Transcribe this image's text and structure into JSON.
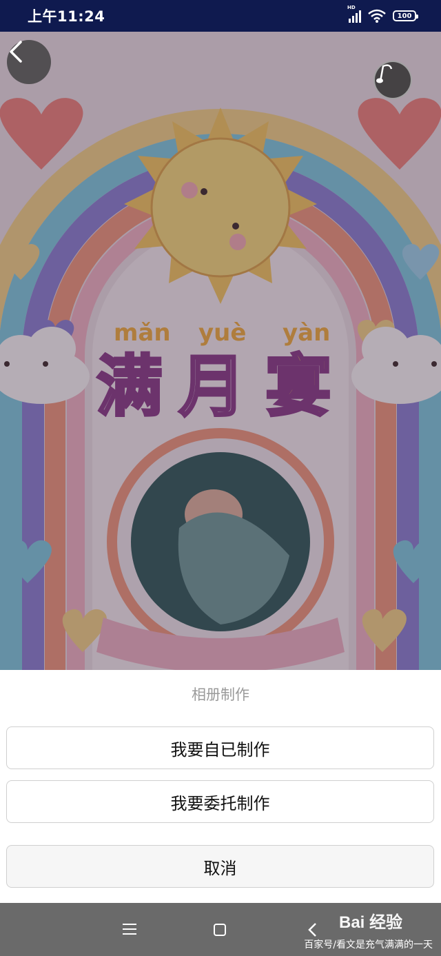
{
  "status_bar": {
    "time": "上午11:24",
    "network": "HD",
    "battery": "100"
  },
  "poster": {
    "pinyin": [
      "mǎn",
      "yuè",
      "yàn"
    ],
    "title_chars": [
      "满",
      "月",
      "宴"
    ]
  },
  "action_sheet": {
    "title": "相册制作",
    "self_make": "我要自已制作",
    "entrust_make": "我要委托制作",
    "cancel": "取消"
  },
  "watermark": {
    "logo": "Bai 经验",
    "caption": "百家号/看文是充气满满的一天"
  },
  "colors": {
    "status_bg": "#0f1a4f",
    "nav_bg": "#6a6a6a",
    "sheet_bg": "#ffffff"
  }
}
